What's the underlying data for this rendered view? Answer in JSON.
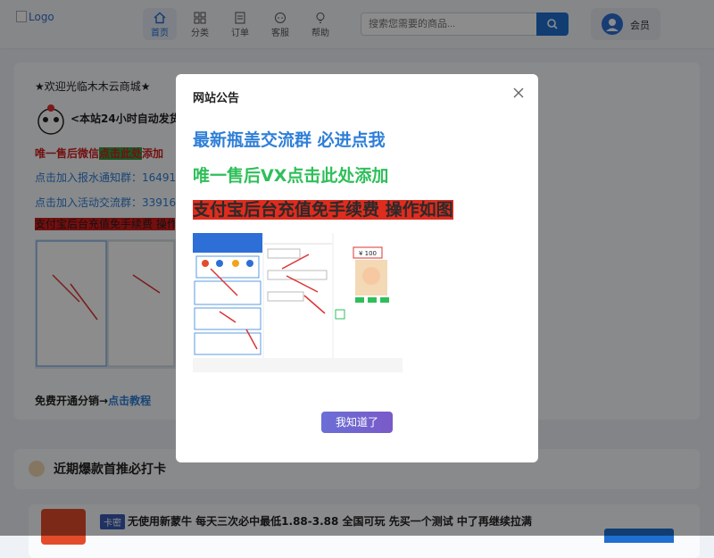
{
  "header": {
    "logo_alt": "Logo",
    "nav": [
      {
        "label": "首页",
        "icon": "home-icon",
        "active": true
      },
      {
        "label": "分类",
        "icon": "grid-icon",
        "active": false
      },
      {
        "label": "订单",
        "icon": "order-icon",
        "active": false
      },
      {
        "label": "客服",
        "icon": "service-icon",
        "active": false
      },
      {
        "label": "帮助",
        "icon": "help-bulb-icon",
        "active": false
      }
    ],
    "search_placeholder": "搜索您需要的商品...",
    "member_label": "会员"
  },
  "background": {
    "welcome": "★欢迎光临木木云商城★",
    "auto_ship": "<本站24小时自动发货>",
    "after_sales_a": "唯一售后微信",
    "after_sales_b": "点击此处",
    "after_sales_c": "添加",
    "notify_group": "点击加入报水通知群：16491710",
    "activity_group": "点击加入活动交流群：33916371",
    "alipay_note": "支付宝后台充值免手续费 操作如图",
    "free_a": "免费开通分销→",
    "free_b": "点击教程",
    "hot_title": "近期爆款首推必打卡",
    "product_tag": "卡密",
    "product_title": "无使用新蒙牛 每天三次必中最低1.88-3.88 全国可玩 先买一个测试 中了再继续拉满"
  },
  "modal": {
    "title": "网站公告",
    "line1": "最新瓶盖交流群 必进点我",
    "line2": "唯一售后VX点击此处添加",
    "line3": "支付宝后台充值免手续费 操作如图",
    "amount": "¥ 100",
    "ok_button": "我知道了"
  },
  "colors": {
    "accent": "#1f6fd1",
    "blue_text": "#2f7fd8",
    "green_text": "#2fbf5a",
    "red_bg": "#de2c1e"
  }
}
